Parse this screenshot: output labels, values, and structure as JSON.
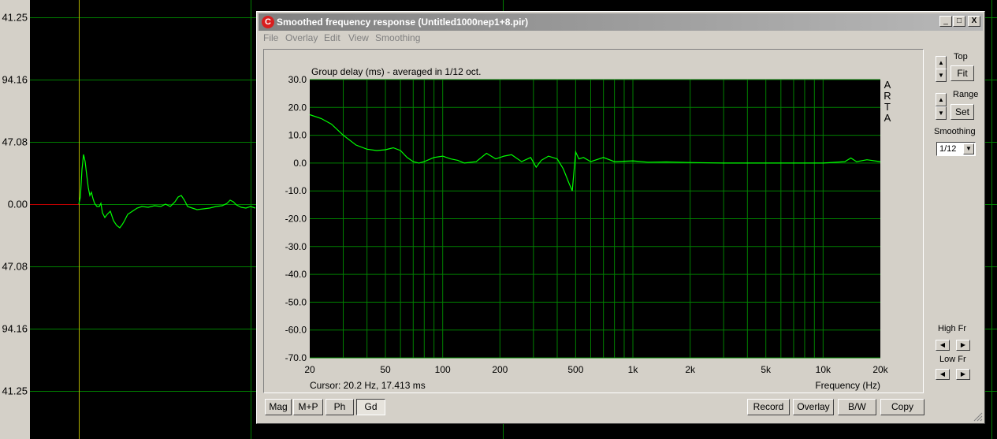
{
  "background": {
    "y_ticks": [
      "41.25",
      "94.16",
      "47.08",
      "0.00",
      "47.08",
      "94.16",
      "41.25"
    ],
    "trace_color": "#00ff00",
    "grid_color": "#008000"
  },
  "window": {
    "title": "Smoothed frequency response (Untitled1000nep1+8.pir)",
    "icon_letter": "C",
    "controls": {
      "minimize": "_",
      "maximize": "□",
      "close": "X"
    },
    "menu": [
      "File",
      "Overlay",
      "Edit",
      "View",
      "Smoothing"
    ]
  },
  "chart": {
    "watermark": [
      "A",
      "R",
      "T",
      "A"
    ],
    "cursor_readout": "Cursor: 20.2 Hz, 17.413 ms",
    "colors": {
      "plot_bg": "#000000",
      "grid": "#008000",
      "trace": "#00ff00"
    }
  },
  "chart_data": {
    "type": "line",
    "title": "Group delay (ms) - averaged in 1/12 oct.",
    "xlabel": "Frequency (Hz)",
    "ylabel": "",
    "xscale": "log",
    "xlim": [
      20,
      20000
    ],
    "ylim": [
      -70,
      30
    ],
    "y_ticks": [
      "30.0",
      "20.0",
      "10.0",
      "0.0",
      "-10.0",
      "-20.0",
      "-30.0",
      "-40.0",
      "-50.0",
      "-60.0",
      "-70.0"
    ],
    "x_ticks": [
      {
        "value": 20,
        "label": "20"
      },
      {
        "value": 50,
        "label": "50"
      },
      {
        "value": 100,
        "label": "100"
      },
      {
        "value": 200,
        "label": "200"
      },
      {
        "value": 500,
        "label": "500"
      },
      {
        "value": 1000,
        "label": "1k"
      },
      {
        "value": 2000,
        "label": "2k"
      },
      {
        "value": 5000,
        "label": "5k"
      },
      {
        "value": 10000,
        "label": "10k"
      },
      {
        "value": 20000,
        "label": "20k"
      }
    ],
    "grid": true,
    "series": [
      {
        "x": [
          20,
          23,
          26,
          30,
          35,
          40,
          45,
          50,
          55,
          60,
          65,
          70,
          75,
          80,
          90,
          100,
          110,
          120,
          130,
          150,
          170,
          190,
          210,
          230,
          260,
          290,
          310,
          330,
          360,
          400,
          430,
          460,
          480,
          500,
          520,
          550,
          600,
          700,
          800,
          1000,
          1200,
          1500,
          2000,
          3000,
          5000,
          7000,
          10000,
          13000,
          14000,
          15000,
          17000,
          20000
        ],
        "y": [
          17.4,
          16,
          14,
          10,
          6.5,
          5,
          4.5,
          4.8,
          5.5,
          4.5,
          2,
          0.5,
          0,
          0.5,
          2,
          2.5,
          1.5,
          1,
          0,
          0.5,
          3.5,
          1.5,
          2.5,
          3,
          0.5,
          2,
          -1.5,
          1,
          2.5,
          1.5,
          -2,
          -7,
          -10,
          4,
          1.5,
          2,
          0.5,
          2,
          0.5,
          0.8,
          0.3,
          0.4,
          0.2,
          0,
          0,
          0,
          0,
          0.5,
          1.8,
          0.5,
          1.2,
          0.5
        ]
      }
    ]
  },
  "bottom_buttons": {
    "left": [
      {
        "label": "Mag",
        "pressed": false
      },
      {
        "label": "M+P",
        "pressed": false
      },
      {
        "label": "Ph",
        "pressed": false
      },
      {
        "label": "Gd",
        "pressed": true
      }
    ],
    "right": [
      "Record",
      "Overlay",
      "B/W",
      "Copy"
    ]
  },
  "side_panel": {
    "top_label": "Top",
    "fit_label": "Fit",
    "range_label": "Range",
    "set_label": "Set",
    "smoothing_label": "Smoothing",
    "smoothing_value": "1/12",
    "high_fr_label": "High Fr",
    "low_fr_label": "Low Fr"
  }
}
